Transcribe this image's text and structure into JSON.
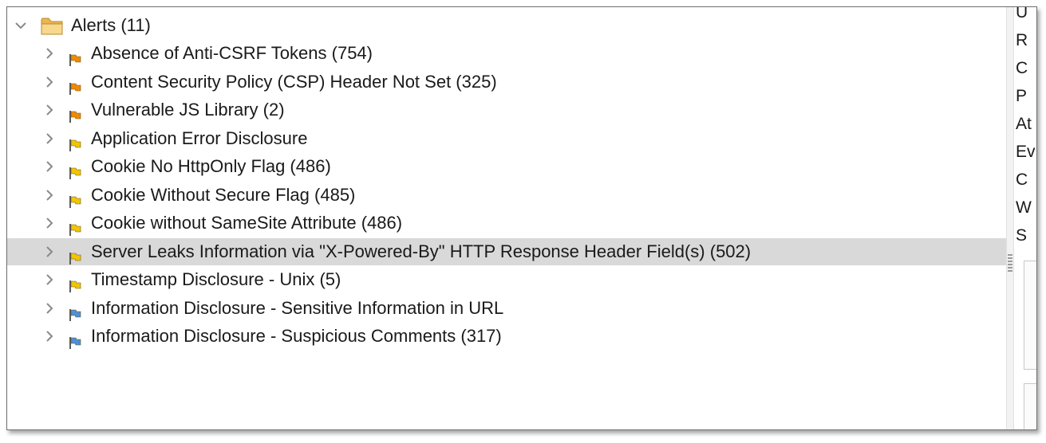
{
  "tree": {
    "root": {
      "label": "Alerts (11)",
      "expanded": true,
      "icon": "folder-icon"
    },
    "items": [
      {
        "label": "Absence of Anti-CSRF Tokens (754)",
        "risk": "medium",
        "flag_color": "#f08a00",
        "selected": false
      },
      {
        "label": "Content Security Policy (CSP) Header Not Set (325)",
        "risk": "medium",
        "flag_color": "#f08a00",
        "selected": false
      },
      {
        "label": "Vulnerable JS Library (2)",
        "risk": "medium",
        "flag_color": "#f08a00",
        "selected": false
      },
      {
        "label": "Application Error Disclosure",
        "risk": "low",
        "flag_color": "#f2c500",
        "selected": false
      },
      {
        "label": "Cookie No HttpOnly Flag (486)",
        "risk": "low",
        "flag_color": "#f2c500",
        "selected": false
      },
      {
        "label": "Cookie Without Secure Flag (485)",
        "risk": "low",
        "flag_color": "#f2c500",
        "selected": false
      },
      {
        "label": "Cookie without SameSite Attribute (486)",
        "risk": "low",
        "flag_color": "#f2c500",
        "selected": false
      },
      {
        "label": "Server Leaks Information via \"X-Powered-By\" HTTP Response Header Field(s) (502)",
        "risk": "low",
        "flag_color": "#f2c500",
        "selected": true
      },
      {
        "label": "Timestamp Disclosure - Unix (5)",
        "risk": "low",
        "flag_color": "#f2c500",
        "selected": false
      },
      {
        "label": "Information Disclosure - Sensitive Information in URL",
        "risk": "informational",
        "flag_color": "#4f8fd6",
        "selected": false
      },
      {
        "label": "Information Disclosure - Suspicious Comments (317)",
        "risk": "informational",
        "flag_color": "#4f8fd6",
        "selected": false
      }
    ]
  },
  "right_panel": {
    "letters": [
      "U",
      "R",
      "C",
      "P",
      "At",
      "Ev",
      "C",
      "W",
      "S"
    ]
  },
  "colors": {
    "selected_row": "#d9d9d9",
    "folder": "#f1c76a"
  }
}
